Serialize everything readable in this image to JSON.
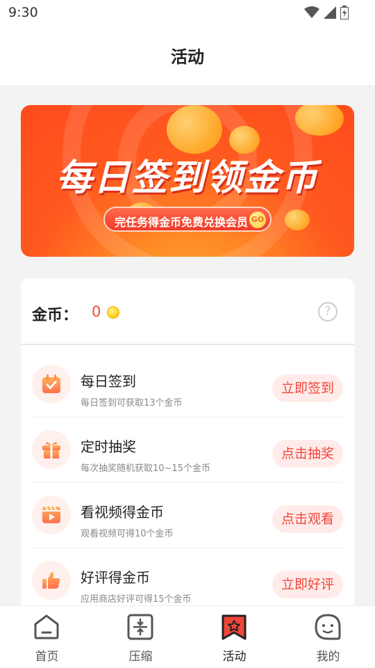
{
  "status_bar": {
    "time": "9:30",
    "icons": [
      "wifi-icon",
      "signal-icon",
      "battery-icon"
    ]
  },
  "header": {
    "title": "活动"
  },
  "banner": {
    "title": "每日签到领金币",
    "subtitle": "完任务得金币免费兑换会员",
    "go": "GO"
  },
  "coins": {
    "label": "金币：",
    "value": "0",
    "help": "?"
  },
  "tasks": [
    {
      "title": "每日签到",
      "desc": "每日签到可获取13个金币",
      "button": "立即签到",
      "icon": "calendar-check-icon"
    },
    {
      "title": "定时抽奖",
      "desc": "每次抽奖随机获取10~15个金币",
      "button": "点击抽奖",
      "icon": "gift-icon"
    },
    {
      "title": "看视频得金币",
      "desc": "观看视频可得10个金币",
      "button": "点击观看",
      "icon": "video-icon"
    },
    {
      "title": "好评得金币",
      "desc": "应用商店好评可得15个金币",
      "button": "立即好评",
      "icon": "thumbs-up-icon"
    }
  ],
  "tabs": [
    {
      "label": "首页",
      "icon": "home-icon",
      "active": false
    },
    {
      "label": "压缩",
      "icon": "compress-icon",
      "active": false
    },
    {
      "label": "活动",
      "icon": "activity-bookmark-icon",
      "active": true
    },
    {
      "label": "我的",
      "icon": "profile-face-icon",
      "active": false
    }
  ],
  "colors": {
    "accent": "#f2453a",
    "accent_light": "#ffecea",
    "banner_start": "#ff4a1c",
    "banner_end": "#ffb13b",
    "icon_gradient_top": "#ffb35a",
    "icon_gradient_bottom": "#ff6f4e"
  }
}
